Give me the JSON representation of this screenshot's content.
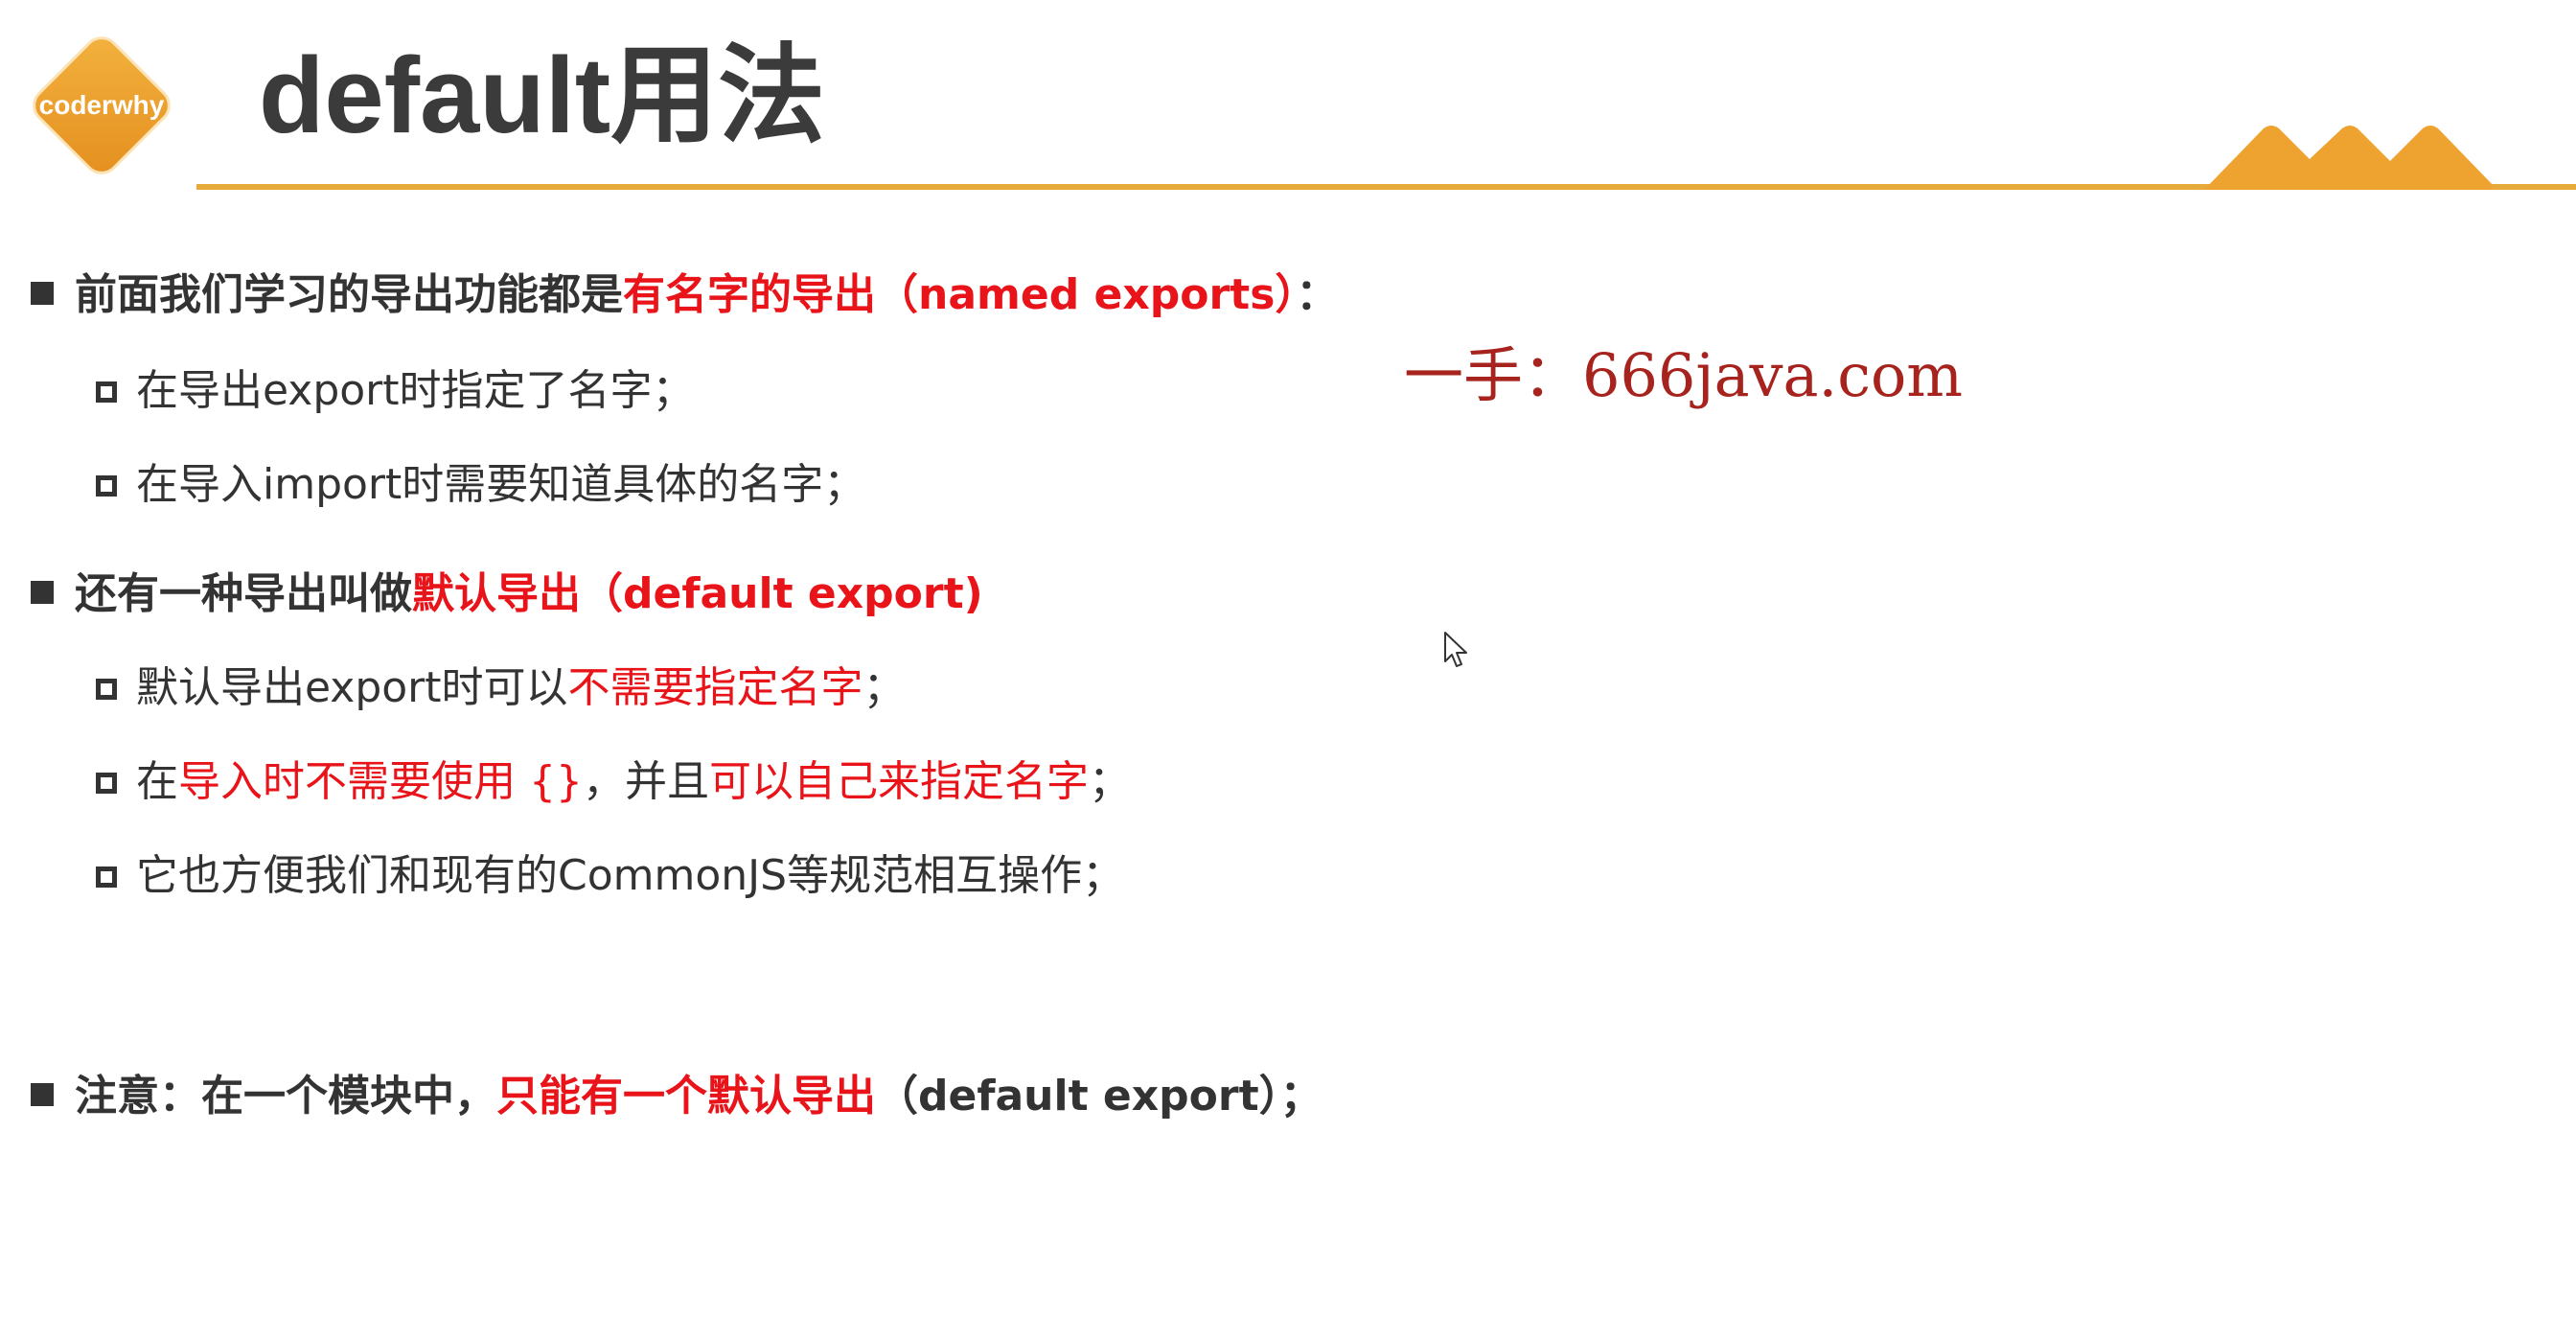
{
  "header": {
    "logo_text": "coderwhy",
    "title": "default用法"
  },
  "watermark": "一手：666java.com",
  "icons": {
    "logo": "orange-diamond-logo",
    "decoration": "mountain-peaks-decoration",
    "cursor": "mouse-pointer-icon",
    "level1_bullet": "filled-square-bullet",
    "level2_bullet": "hollow-square-bullet"
  },
  "colors": {
    "accent": "#e8a93b",
    "highlight": "#e8141a",
    "text": "#333333",
    "watermark": "#a6231e"
  },
  "content": {
    "b1": {
      "t1": "前面我们学习的导出功能都是",
      "t2": "有名字的导出（named exports）",
      "t3": "："
    },
    "b1a": "在导出export时指定了名字；",
    "b1b": "在导入import时需要知道具体的名字；",
    "b2": {
      "t1": "还有一种导出叫做",
      "t2": "默认导出（default export)"
    },
    "b2a": {
      "t1": "默认导出export时可以",
      "t2": "不需要指定名字",
      "t3": "；"
    },
    "b2b": {
      "t1": "在",
      "t2": "导入时不需要使用 {}",
      "t3": "，并且",
      "t4": "可以自己来指定名字",
      "t5": "；"
    },
    "b2c": "它也方便我们和现有的CommonJS等规范相互操作；",
    "b3": {
      "t1": "注意：在一个模块中，",
      "t2": "只能有一个默认导出",
      "t3": "（default export）；"
    }
  }
}
